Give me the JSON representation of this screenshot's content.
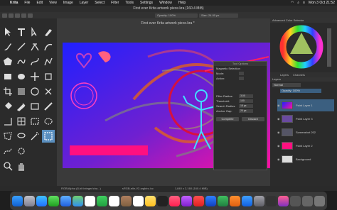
{
  "menubar": {
    "app_name": "Krita",
    "menus": [
      "File",
      "Edit",
      "View",
      "Image",
      "Layer",
      "Select",
      "Filter",
      "Tools",
      "Settings",
      "Window",
      "Help"
    ],
    "datetime": "Mon 3 Oct 21:52"
  },
  "window": {
    "title": "First ever Krita artwork piece.kra (160.4 MiB)"
  },
  "tool_options": {
    "opacity_label": "Opacity: 100%",
    "size_label": "Size: 24.00 px"
  },
  "document": {
    "tab_title": "First ever Krita artwork piece.kra *"
  },
  "selection_dialog": {
    "title": "Tool Options",
    "section": "Magnetic Selection",
    "mode_label": "Mode:",
    "action_label": "Action:",
    "filter_radius_label": "Filter Radius:",
    "filter_radius_value": "3.00",
    "threshold_label": "Threshold:",
    "threshold_value": "100",
    "search_radius_label": "Search Radius:",
    "search_radius_value": "15 px",
    "anchor_gap_label": "Anchor Gap:",
    "anchor_gap_value": "20 px",
    "complete_label": "Complete",
    "discard_label": "Discard"
  },
  "right_panel": {
    "color_selector_title": "Advanced Color Selector",
    "layers_tab": "Layers",
    "channels_tab": "Channels",
    "layers_title": "Layers",
    "blend_mode": "Normal",
    "opacity_label": "Opacity: 100%",
    "layers": [
      {
        "name": "Paint Layer 1",
        "selected": true
      },
      {
        "name": "Paint Layer 3",
        "selected": false
      },
      {
        "name": "Screenshot 202",
        "selected": false
      },
      {
        "name": "Paint Layer 2",
        "selected": false
      },
      {
        "name": "Background",
        "selected": false
      }
    ]
  },
  "statusbar": {
    "color_profile": "RGB/Alpha (8-bit integer/cha...)",
    "icc": "sRGB-elle-V2-srgbtrc.icc",
    "dimensions": "1,840 x 2,160 (160.4 MiB)"
  },
  "colors": {
    "accent": "#5a8fbf",
    "canvas_blue": "#1a1aff",
    "canvas_magenta": "#ff00aa"
  }
}
